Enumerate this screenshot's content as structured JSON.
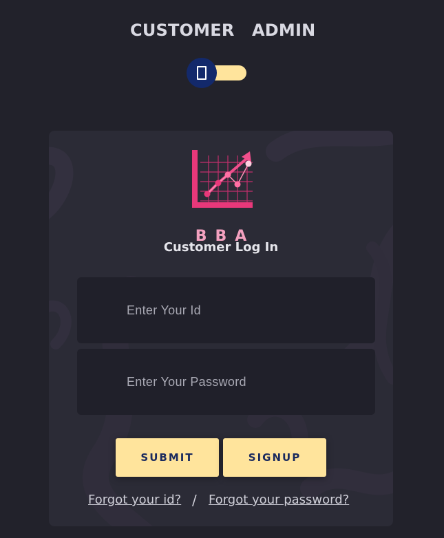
{
  "tabs": {
    "customer": "CUSTOMER",
    "admin": "ADMIN"
  },
  "toggle": {
    "state": "customer",
    "knob_color": "#13296b",
    "track_color": "#ffe49c"
  },
  "logo": {
    "text": "BBA",
    "icon": "growth-chart-icon",
    "color": "#e8387a"
  },
  "form": {
    "title": "Customer Log In",
    "id_placeholder": "Enter Your Id",
    "password_placeholder": "Enter Your Password",
    "submit_label": "SUBMIT",
    "signup_label": "SIGNUP"
  },
  "links": {
    "forgot_id": "Forgot your id?",
    "separator": "/",
    "forgot_password": "Forgot your password?"
  },
  "colors": {
    "background": "#22222b",
    "card": "#2b2b36",
    "field": "#20202a",
    "button": "#ffe49c",
    "button_text": "#1a2a5e"
  }
}
